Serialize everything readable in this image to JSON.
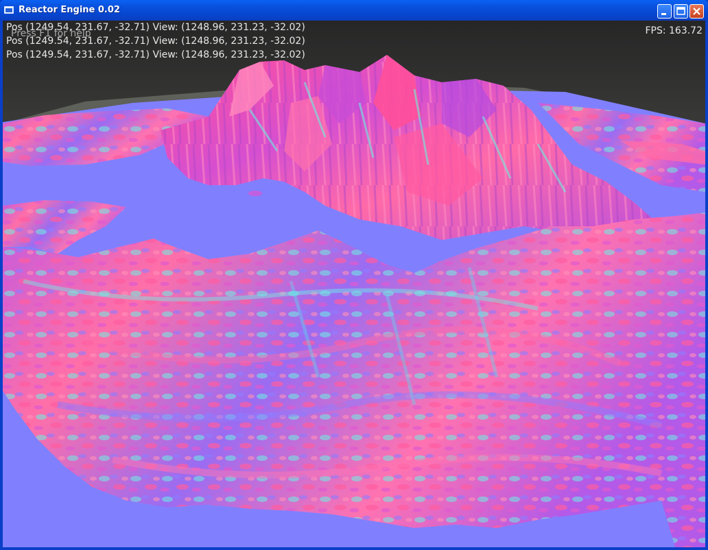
{
  "window": {
    "title": "Reactor Engine 0.02",
    "buttons": {
      "minimize": "minimize",
      "maximize": "maximize",
      "close": "close"
    }
  },
  "hud": {
    "help": "Press F1 for help",
    "pos_lines": [
      "Pos (1249.54, 231.67, -32.71) View: (1248.96, 231.23, -32.02)",
      "Pos (1249.54, 231.67, -32.71) View: (1248.96, 231.23, -32.02)",
      "Pos (1249.54, 231.67, -32.71) View: (1248.96, 231.23, -32.02)"
    ],
    "fps": "FPS: 163.72"
  },
  "colors": {
    "flat": "#8080ff",
    "pink": "#ff5fa5",
    "magenta": "#c850d8",
    "cyan": "#5ff0e0",
    "sky": "#2e2e2e",
    "ground": "#6a6a64"
  },
  "icons": {
    "app": "window-icon"
  }
}
